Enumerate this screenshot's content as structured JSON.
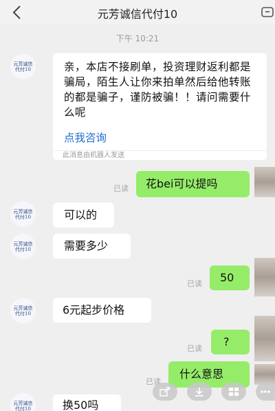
{
  "header": {
    "title": "元芳诚信代付10"
  },
  "timestamp": "下午 10:21",
  "contact": {
    "avatar_text": "元芳诚信代付10"
  },
  "messages": [
    {
      "id": 1,
      "sender": "contact",
      "text": "亲，本店不接刷单，投资理财返利都是骗局，陌生人让你来拍单然后给他转账的都是骗子，谨防被骗！！请问需要什么呢",
      "link": "点我咨询",
      "footnote": "此消息由机器人发送"
    },
    {
      "id": 2,
      "sender": "me",
      "text": "花bei可以提吗",
      "status": "已读"
    },
    {
      "id": 3,
      "sender": "contact",
      "text": "可以的"
    },
    {
      "id": 4,
      "sender": "contact",
      "text": "需要多少"
    },
    {
      "id": 5,
      "sender": "me",
      "text": "50",
      "status": "已读"
    },
    {
      "id": 6,
      "sender": "contact",
      "text": "6元起步价格"
    },
    {
      "id": 7,
      "sender": "me",
      "text": "?",
      "status": "已读"
    },
    {
      "id": 8,
      "sender": "me",
      "text": "什么意思",
      "status": "已读"
    },
    {
      "id": 9,
      "sender": "contact",
      "text": "换50吗"
    }
  ],
  "colors": {
    "outgoing_bubble": "#95ec69",
    "incoming_bubble": "#ffffff",
    "link": "#1f6fcf",
    "background": "#efefef"
  },
  "icons": {
    "back": "chevron-left-icon",
    "more": "more-icon",
    "toolbar": [
      "forward-icon",
      "download-icon",
      "grid-icon",
      "ellipsis-icon"
    ]
  }
}
